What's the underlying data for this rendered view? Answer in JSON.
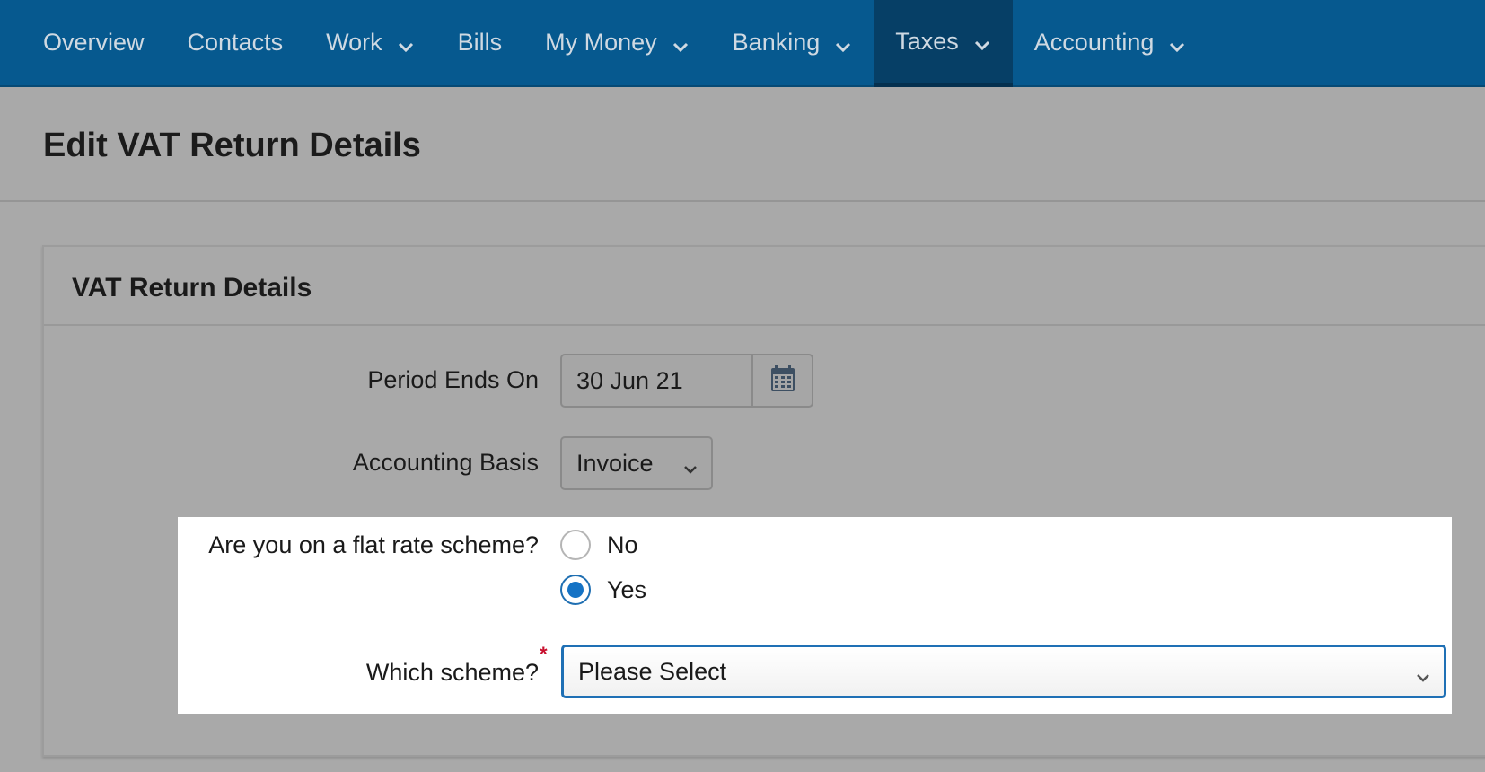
{
  "nav": {
    "items": [
      {
        "label": "Overview",
        "dropdown": false
      },
      {
        "label": "Contacts",
        "dropdown": false
      },
      {
        "label": "Work",
        "dropdown": true
      },
      {
        "label": "Bills",
        "dropdown": false
      },
      {
        "label": "My Money",
        "dropdown": true
      },
      {
        "label": "Banking",
        "dropdown": true
      },
      {
        "label": "Taxes",
        "dropdown": true,
        "active": true
      },
      {
        "label": "Accounting",
        "dropdown": true
      }
    ]
  },
  "page": {
    "title": "Edit VAT Return Details"
  },
  "panel": {
    "title": "VAT Return Details",
    "period_label": "Period Ends On",
    "period_value": "30 Jun 21",
    "calendar_icon": "calendar-icon",
    "basis_label": "Accounting Basis",
    "basis_value": "Invoice",
    "flat_rate_label": "Are you on a flat rate scheme?",
    "flat_rate_options": [
      {
        "label": "No",
        "checked": false
      },
      {
        "label": "Yes",
        "checked": true
      }
    ],
    "scheme_label": "Which scheme?",
    "scheme_required": "*",
    "scheme_value": "Please Select"
  },
  "colors": {
    "nav_bg": "#06598f",
    "nav_active": "#063f66",
    "accent": "#1573c5",
    "required": "#c8102e"
  }
}
